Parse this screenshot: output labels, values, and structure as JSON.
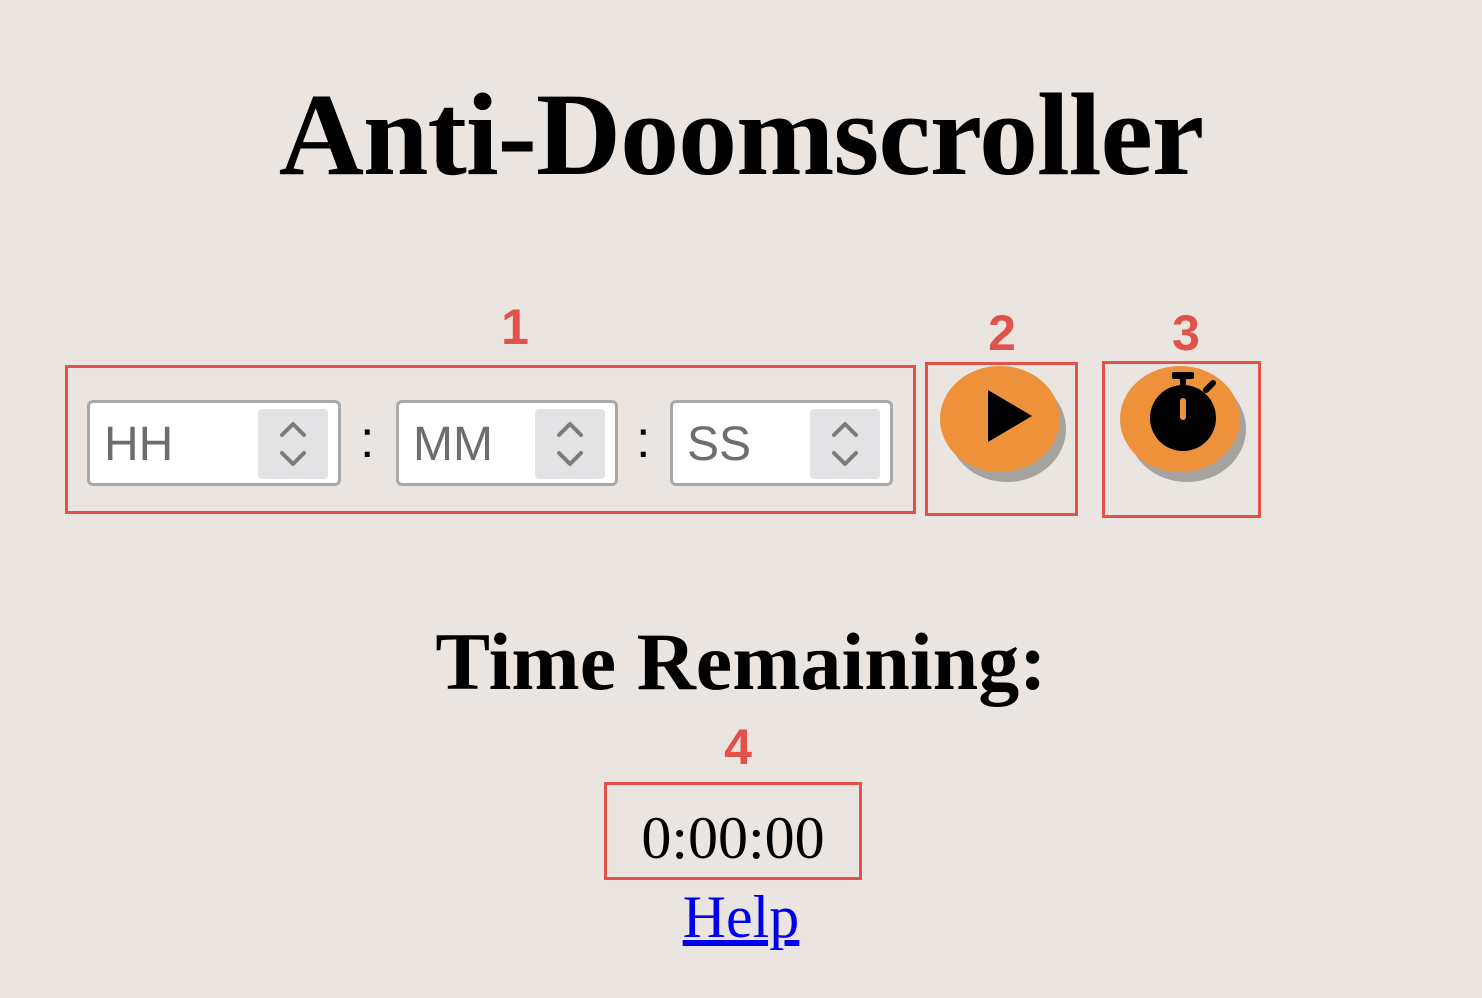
{
  "app": {
    "title": "Anti-Doomscroller"
  },
  "timer_input": {
    "hours": {
      "placeholder": "HH"
    },
    "separator_1": ":",
    "minutes": {
      "placeholder": "MM"
    },
    "separator_2": ":",
    "seconds": {
      "placeholder": "SS"
    }
  },
  "buttons": {
    "start": {
      "icon": "play-icon",
      "color": "#ed913b"
    },
    "stopwatch": {
      "icon": "stopwatch-icon",
      "color": "#ed913b"
    }
  },
  "status": {
    "heading": "Time Remaining:",
    "remaining": "0:00:00"
  },
  "help": {
    "label": "Help"
  },
  "annotations": {
    "color": "#e1524b",
    "labels": [
      "1",
      "2",
      "3",
      "4"
    ]
  }
}
